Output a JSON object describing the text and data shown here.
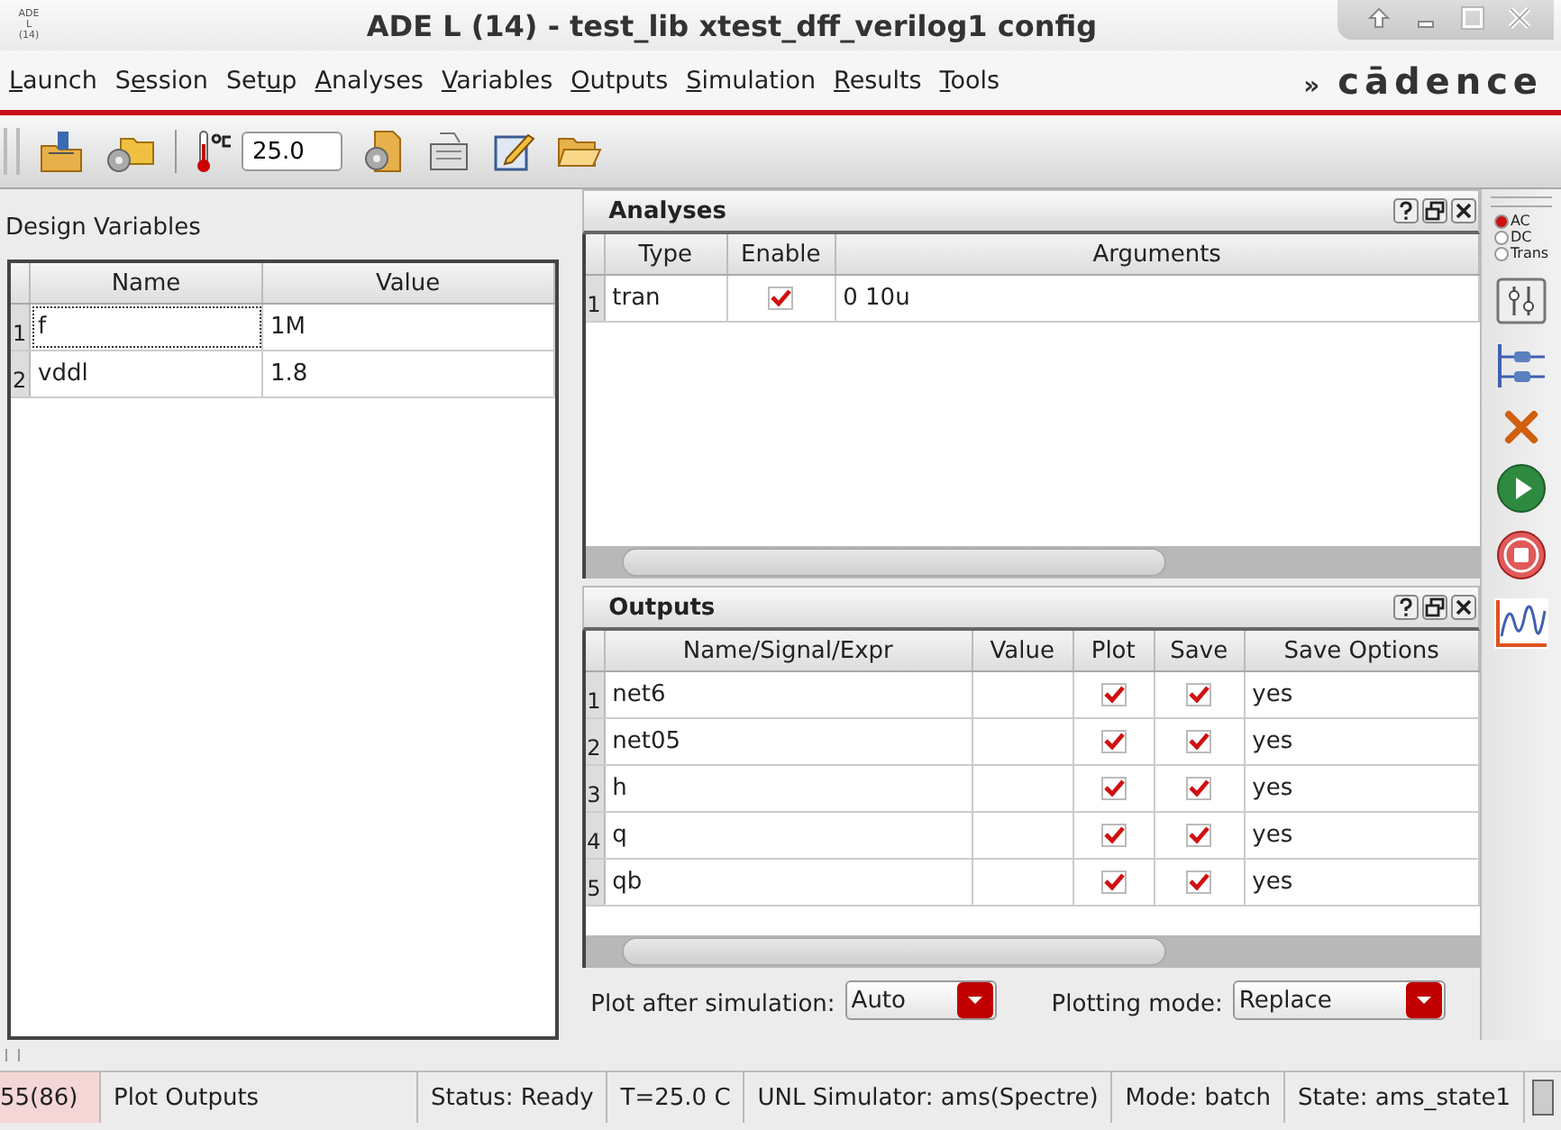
{
  "window": {
    "title": "ADE L (14) - test_lib xtest_dff_verilog1 config",
    "app_icon_lines": [
      "ADE",
      "L",
      "(14)"
    ]
  },
  "menu": [
    {
      "key": "L",
      "post": "aunch"
    },
    {
      "pre": "S",
      "key": "e",
      "post": "ssion"
    },
    {
      "pre": "Set",
      "key": "u",
      "post": "p"
    },
    {
      "key": "A",
      "post": "nalyses"
    },
    {
      "key": "V",
      "post": "ariables"
    },
    {
      "key": "O",
      "post": "utputs"
    },
    {
      "key": "S",
      "post": "imulation"
    },
    {
      "key": "R",
      "post": "esults"
    },
    {
      "key": "T",
      "post": "ools"
    }
  ],
  "brand": {
    "mark": "»",
    "name": "cādence"
  },
  "toolbar": {
    "temperature": "25.0"
  },
  "design_variables": {
    "title": "Design Variables",
    "columns": [
      "Name",
      "Value"
    ],
    "rows": [
      {
        "index": "1",
        "name": "f",
        "value": "1M",
        "focused": true
      },
      {
        "index": "2",
        "name": "vddl",
        "value": "1.8",
        "focused": false
      }
    ]
  },
  "analyses": {
    "title": "Analyses",
    "columns": [
      "Type",
      "Enable",
      "Arguments"
    ],
    "rows": [
      {
        "index": "1",
        "type": "tran",
        "enabled": true,
        "arguments": "0 10u"
      }
    ]
  },
  "outputs": {
    "title": "Outputs",
    "columns": [
      "Name/Signal/Expr",
      "Value",
      "Plot",
      "Save",
      "Save Options"
    ],
    "rows": [
      {
        "index": "1",
        "name": "net6",
        "plot": true,
        "save": true,
        "save_options": "yes"
      },
      {
        "index": "2",
        "name": "net05",
        "plot": true,
        "save": true,
        "save_options": "yes"
      },
      {
        "index": "3",
        "name": "h",
        "plot": true,
        "save": true,
        "save_options": "yes"
      },
      {
        "index": "4",
        "name": "q",
        "plot": true,
        "save": true,
        "save_options": "yes"
      },
      {
        "index": "5",
        "name": "qb",
        "plot": true,
        "save": true,
        "save_options": "yes"
      }
    ],
    "plot_after": {
      "label": "Plot after simulation:",
      "value": "Auto"
    },
    "plotting_mode": {
      "label": "Plotting mode:",
      "value": "Replace"
    }
  },
  "side_toolbar": {
    "analysis_types": [
      {
        "label": "AC",
        "selected": true
      },
      {
        "label": "DC",
        "selected": false
      },
      {
        "label": "Trans",
        "selected": false
      }
    ]
  },
  "status_bar": [
    {
      "text": "55(86)",
      "highlighted": true
    },
    {
      "text": "Plot Outputs",
      "highlighted": false
    },
    {
      "text": "Status: Ready",
      "highlighted": false
    },
    {
      "text": "T=25.0 C",
      "highlighted": false
    },
    {
      "text": "UNL Simulator: ams(Spectre)",
      "highlighted": false
    },
    {
      "text": "Mode: batch",
      "highlighted": false
    },
    {
      "text": "State: ams_state1",
      "highlighted": false
    }
  ]
}
